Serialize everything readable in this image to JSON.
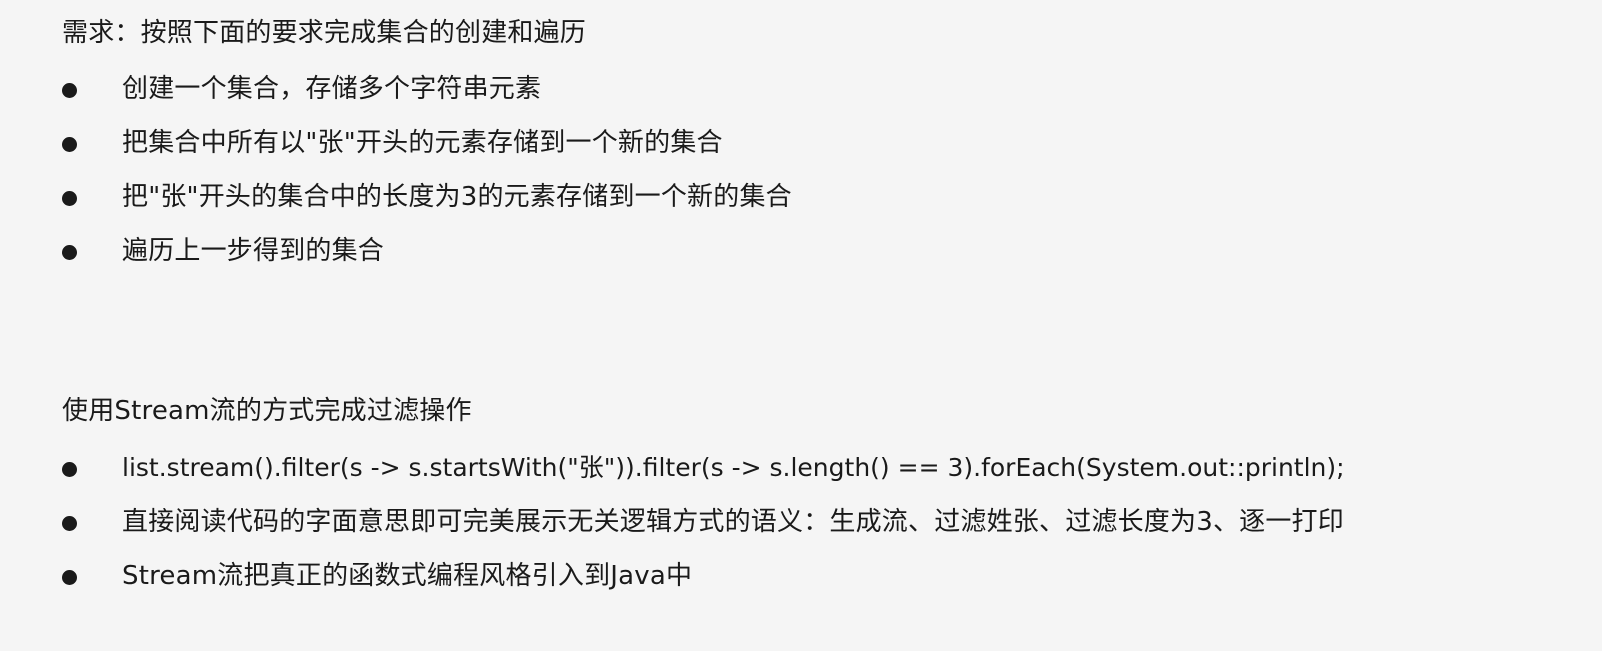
{
  "section1": {
    "title": "需求：按照下面的要求完成集合的创建和遍历",
    "items": [
      "创建一个集合，存储多个字符串元素",
      "把集合中所有以\"张\"开头的元素存储到一个新的集合",
      "把\"张\"开头的集合中的长度为3的元素存储到一个新的集合",
      "遍历上一步得到的集合"
    ]
  },
  "section2": {
    "title": "使用Stream流的方式完成过滤操作",
    "items": [
      "list.stream().filter(s -> s.startsWith(\"张\")).filter(s -> s.length() == 3).forEach(System.out::println);",
      "直接阅读代码的字面意思即可完美展示无关逻辑方式的语义：生成流、过滤姓张、过滤长度为3、逐一打印",
      "Stream流把真正的函数式编程风格引入到Java中"
    ]
  }
}
